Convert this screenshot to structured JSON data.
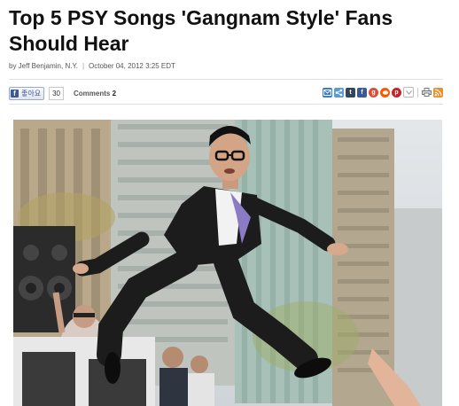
{
  "article": {
    "title": "Top 5 PSY Songs 'Gangnam Style' Fans Should Hear",
    "byline": "by Jeff Benjamin, N.Y.",
    "date": "October 04, 2012 3:25 EDT"
  },
  "social": {
    "like_label": "좋아요",
    "like_count": "30",
    "comments_label": "Comments",
    "comments_count": "2"
  },
  "share_icons": [
    {
      "name": "email-icon",
      "color": "#3a7cc7"
    },
    {
      "name": "share-icon",
      "color": "#5a9bd5"
    },
    {
      "name": "tumblr-icon",
      "color": "#35465c"
    },
    {
      "name": "facebook-icon",
      "color": "#3b5998"
    },
    {
      "name": "google-plus-icon",
      "color": "#dd4b39"
    },
    {
      "name": "reddit-icon",
      "color": "#ff5700"
    },
    {
      "name": "pinterest-icon",
      "color": "#cb2027"
    },
    {
      "name": "more-icon",
      "color": "#9a9a9a"
    },
    {
      "name": "print-icon",
      "color": "#777777"
    },
    {
      "name": "rss-icon",
      "color": "#f28c28"
    }
  ],
  "colors": {
    "title": "#111111",
    "facebook": "#3b5998",
    "rule": "#e2e2e2"
  }
}
